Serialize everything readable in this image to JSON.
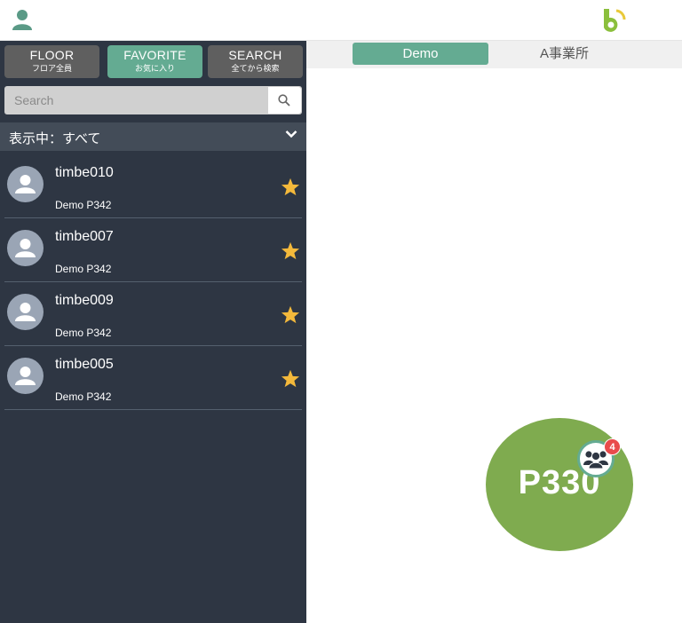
{
  "header": {
    "user_icon": "user-icon",
    "logo_icon": "app-logo"
  },
  "modes": [
    {
      "label": "FLOOR",
      "sub": "フロア全員",
      "active": false
    },
    {
      "label": "FAVORITE",
      "sub": "お気に入り",
      "active": true
    },
    {
      "label": "SEARCH",
      "sub": "全てから検索",
      "active": false
    }
  ],
  "search": {
    "placeholder": "Search",
    "value": ""
  },
  "filter": {
    "label": "表示中：すべて"
  },
  "users": [
    {
      "name": "timbe010",
      "location": "Demo P342",
      "favorite": true
    },
    {
      "name": "timbe007",
      "location": "Demo P342",
      "favorite": true
    },
    {
      "name": "timbe009",
      "location": "Demo P342",
      "favorite": true
    },
    {
      "name": "timbe005",
      "location": "Demo P342",
      "favorite": true
    }
  ],
  "tabs": [
    {
      "label": "Demo",
      "active": true
    },
    {
      "label": "A事業所",
      "active": false
    }
  ],
  "map": {
    "room_label": "P330",
    "group_count": "4"
  },
  "colors": {
    "accent": "#64ab92",
    "sidebar_bg": "#2e3643",
    "room": "#7fab4f",
    "star": "#f4b93b",
    "badge": "#e94b4b"
  }
}
